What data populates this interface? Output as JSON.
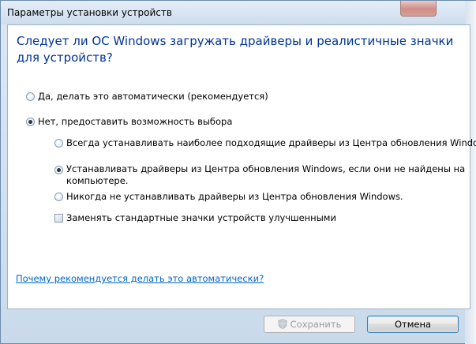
{
  "window": {
    "title": "Параметры установки устройств"
  },
  "heading": "Следует ли ОС Windows загружать драйверы и реалистичные значки для устройств?",
  "options": {
    "auto": "Да, делать это автоматически (рекомендуется)",
    "manual": "Нет, предоставить возможность выбора",
    "always": "Всегда устанавливать наиболее подходящие драйверы из Центра обновления Windows.",
    "if_not_found_line1": "Устанавливать драйверы из Центра обновления Windows, если они не найдены на",
    "if_not_found_line2": "компьютере.",
    "never": "Никогда не устанавливать драйверы из Центра обновления Windows.",
    "replace_icons": "Заменять стандартные значки устройств улучшенными"
  },
  "link": "Почему рекомендуется делать это автоматически?",
  "buttons": {
    "save": "Сохранить",
    "cancel": "Отмена"
  },
  "icons": {
    "save": "uac-shield-icon"
  },
  "colors": {
    "heading": "#003399",
    "link": "#0066cc"
  }
}
